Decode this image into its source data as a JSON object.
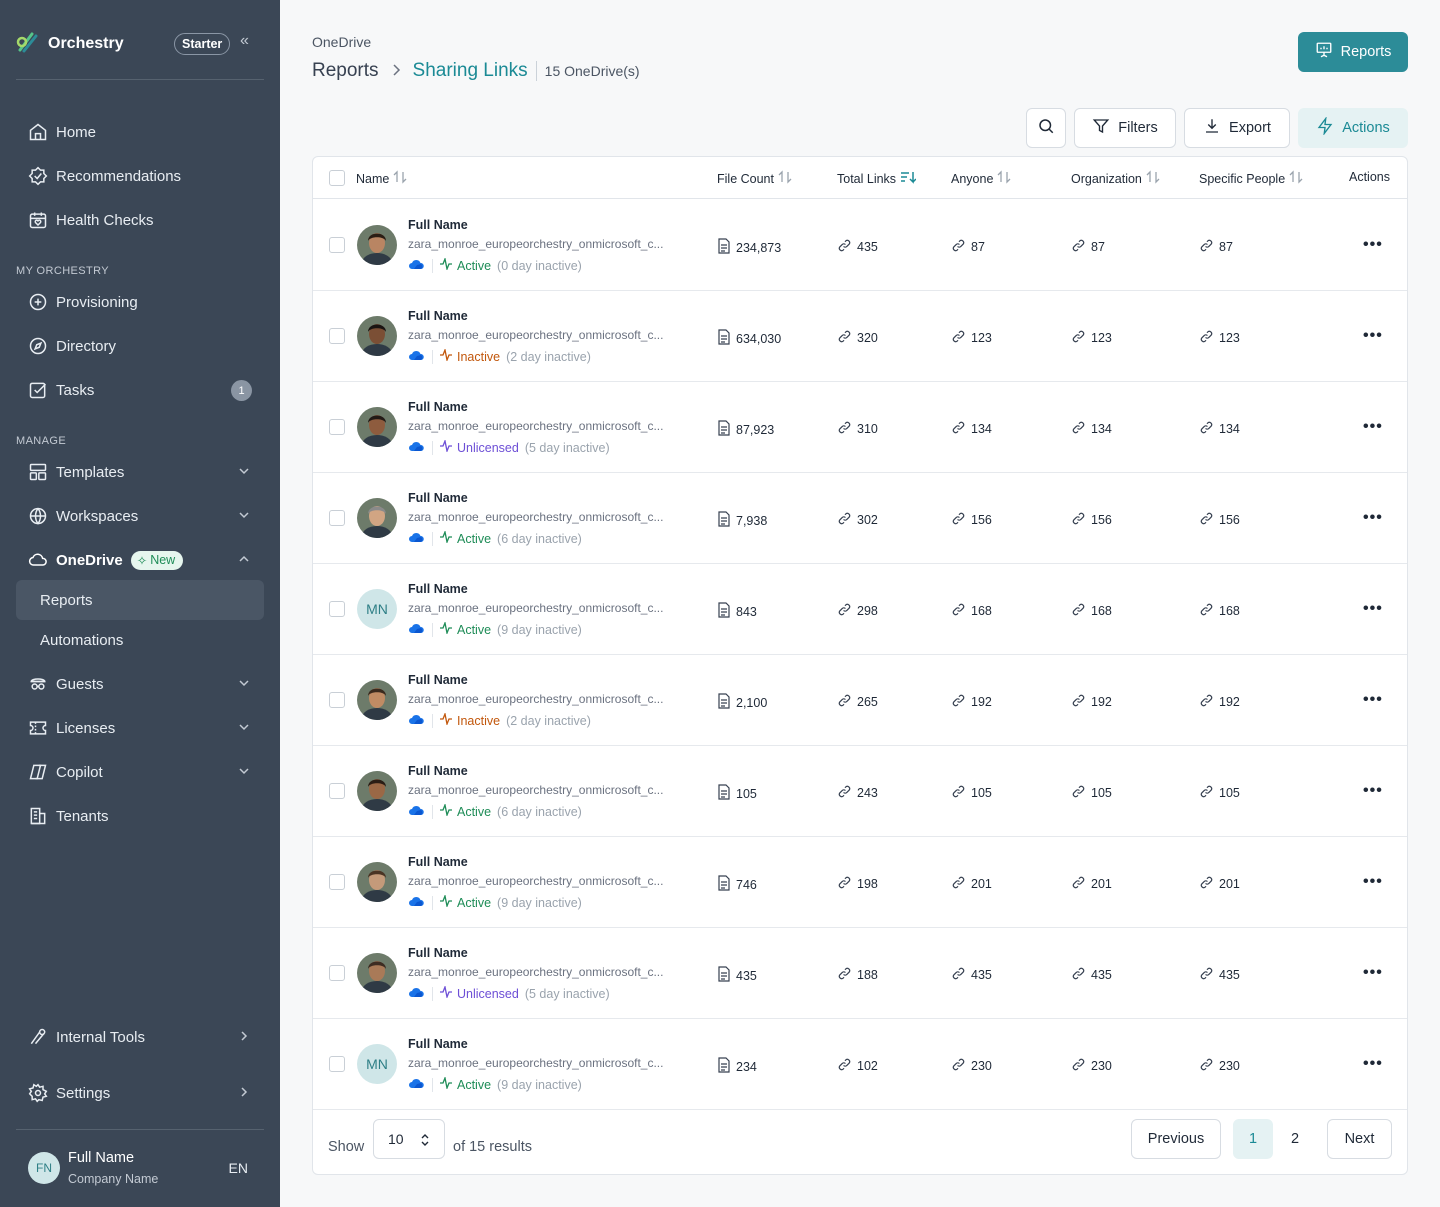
{
  "app": {
    "name": "Orchestry",
    "plan": "Starter"
  },
  "sidebar": {
    "home": "Home",
    "recommendations": "Recommendations",
    "health_checks": "Health Checks",
    "section_my": "MY ORCHESTRY",
    "provisioning": "Provisioning",
    "directory": "Directory",
    "tasks": "Tasks",
    "tasks_badge": "1",
    "section_manage": "MANAGE",
    "templates": "Templates",
    "workspaces": "Workspaces",
    "onedrive": "OneDrive",
    "new_badge": "New",
    "reports": "Reports",
    "automations": "Automations",
    "guests": "Guests",
    "licenses": "Licenses",
    "copilot": "Copilot",
    "tenants": "Tenants",
    "internal_tools": "Internal Tools",
    "settings": "Settings"
  },
  "user": {
    "initials": "FN",
    "name": "Full Name",
    "company": "Company Name",
    "lang": "EN"
  },
  "header": {
    "breadcrumb_top": "OneDrive",
    "breadcrumb_parent": "Reports",
    "title": "Sharing Links",
    "count": "15 OneDrive(s)",
    "reports_button": "Reports"
  },
  "toolbar": {
    "filters": "Filters",
    "export": "Export",
    "actions": "Actions"
  },
  "columns": {
    "name": "Name",
    "file_count": "File Count",
    "total_links": "Total Links",
    "anyone": "Anyone",
    "organization": "Organization",
    "specific_people": "Specific People",
    "actions": "Actions"
  },
  "rows": [
    {
      "name": "Full Name",
      "email": "zara_monroe_europeorchestry_onmicrosoft_c...",
      "status": "Active",
      "note": "(0 day inactive)",
      "avatar": "photo",
      "files": "234,873",
      "links": "435",
      "anyone": "87",
      "org": "87",
      "specific": "87"
    },
    {
      "name": "Full Name",
      "email": "zara_monroe_europeorchestry_onmicrosoft_c...",
      "status": "Inactive",
      "note": "(2 day inactive)",
      "avatar": "photo",
      "files": "634,030",
      "links": "320",
      "anyone": "123",
      "org": "123",
      "specific": "123"
    },
    {
      "name": "Full Name",
      "email": "zara_monroe_europeorchestry_onmicrosoft_c...",
      "status": "Unlicensed",
      "note": "(5 day inactive)",
      "avatar": "photo",
      "files": "87,923",
      "links": "310",
      "anyone": "134",
      "org": "134",
      "specific": "134"
    },
    {
      "name": "Full Name",
      "email": "zara_monroe_europeorchestry_onmicrosoft_c...",
      "status": "Active",
      "note": "(6 day inactive)",
      "avatar": "photo",
      "files": "7,938",
      "links": "302",
      "anyone": "156",
      "org": "156",
      "specific": "156"
    },
    {
      "name": "Full Name",
      "email": "zara_monroe_europeorchestry_onmicrosoft_c...",
      "status": "Active",
      "note": "(9 day inactive)",
      "avatar": "MN",
      "files": "843",
      "links": "298",
      "anyone": "168",
      "org": "168",
      "specific": "168"
    },
    {
      "name": "Full Name",
      "email": "zara_monroe_europeorchestry_onmicrosoft_c...",
      "status": "Inactive",
      "note": "(2 day inactive)",
      "avatar": "photo",
      "files": "2,100",
      "links": "265",
      "anyone": "192",
      "org": "192",
      "specific": "192"
    },
    {
      "name": "Full Name",
      "email": "zara_monroe_europeorchestry_onmicrosoft_c...",
      "status": "Active",
      "note": "(6 day inactive)",
      "avatar": "photo",
      "files": "105",
      "links": "243",
      "anyone": "105",
      "org": "105",
      "specific": "105"
    },
    {
      "name": "Full Name",
      "email": "zara_monroe_europeorchestry_onmicrosoft_c...",
      "status": "Active",
      "note": "(9 day inactive)",
      "avatar": "photo",
      "files": "746",
      "links": "198",
      "anyone": "201",
      "org": "201",
      "specific": "201"
    },
    {
      "name": "Full Name",
      "email": "zara_monroe_europeorchestry_onmicrosoft_c...",
      "status": "Unlicensed",
      "note": "(5 day inactive)",
      "avatar": "photo",
      "files": "435",
      "links": "188",
      "anyone": "435",
      "org": "435",
      "specific": "435"
    },
    {
      "name": "Full Name",
      "email": "zara_monroe_europeorchestry_onmicrosoft_c...",
      "status": "Active",
      "note": "(9 day inactive)",
      "avatar": "MN",
      "files": "234",
      "links": "102",
      "anyone": "230",
      "org": "230",
      "specific": "230"
    }
  ],
  "pagination": {
    "show_label": "Show",
    "page_size": "10",
    "results": "of 15 results",
    "previous": "Previous",
    "page1": "1",
    "page2": "2",
    "next": "Next"
  },
  "colors": {
    "sidebar": "#3b4756",
    "accent": "#2c8c98",
    "active": "#1e8c57",
    "inactive": "#c2570c",
    "unlicensed": "#6d4fd6"
  }
}
